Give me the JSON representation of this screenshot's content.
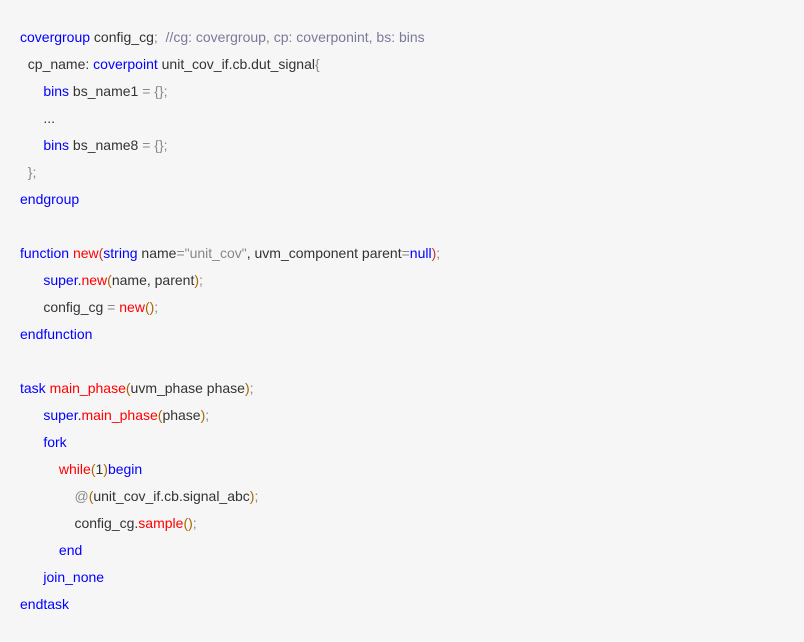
{
  "lines": {
    "l1": {
      "covergroup": "covergroup",
      "config_cg": " config_cg",
      "semi": ";",
      "sp": "  ",
      "comment": "//cg: covergroup, cp: coverponint, bs: bins"
    },
    "l2": {
      "indent": "  ",
      "cp_name": "cp_name: ",
      "coverpoint": "coverpoint",
      "path": " unit_cov_if.cb.dut_signal",
      "brace": "{"
    },
    "l3": {
      "indent": "      ",
      "bins": "bins",
      "name": " bs_name1 ",
      "eq": "= ",
      "braces": "{}",
      "semi": ";"
    },
    "l4": {
      "indent": "      ",
      "dots": "..."
    },
    "l5": {
      "indent": "      ",
      "bins": "bins",
      "name": " bs_name8 ",
      "eq": "= ",
      "braces": "{}",
      "semi": ";"
    },
    "l6": {
      "indent": "  ",
      "brace": "}",
      "semi": ";"
    },
    "l7": {
      "endgroup": "endgroup"
    },
    "l8": {
      "blank": ""
    },
    "l9": {
      "function": "function",
      "sp": " ",
      "new": "new",
      "lp": "(",
      "string": "string",
      "name_eq": " name",
      "eq": "=",
      "str": "\"unit_cov\"",
      "comma": ", uvm_component parent",
      "eq2": "=",
      "null": "null",
      "rp": ")",
      "semi": ";"
    },
    "l10": {
      "indent": "      ",
      "super": "super",
      "dot": ".",
      "new": "new",
      "lp": "(",
      "args": "name, parent",
      "rp": ")",
      "semi": ";"
    },
    "l11": {
      "indent": "      ",
      "config": "config_cg ",
      "eq": "= ",
      "new": "new",
      "lp": "(",
      "rp": ")",
      "semi": ";"
    },
    "l12": {
      "endfunction": "endfunction"
    },
    "l13": {
      "blank": ""
    },
    "l14": {
      "task": "task",
      "sp": " ",
      "main_phase": "main_phase",
      "lp": "(",
      "args": "uvm_phase phase",
      "rp": ")",
      "semi": ";"
    },
    "l15": {
      "indent": "      ",
      "super": "super",
      "dot": ".",
      "main_phase": "main_phase",
      "lp": "(",
      "args": "phase",
      "rp": ")",
      "semi": ";"
    },
    "l16": {
      "indent": "      ",
      "fork": "fork"
    },
    "l17": {
      "indent": "          ",
      "while": "while",
      "lp": "(",
      "one": "1",
      "rp": ")",
      "begin": "begin"
    },
    "l18": {
      "indent": "              ",
      "at": "@",
      "lp": "(",
      "path": "unit_cov_if.cb.signal_abc",
      "rp": ")",
      "semi": ";"
    },
    "l19": {
      "indent": "              ",
      "config": "config_cg.",
      "sample": "sample",
      "lp": "(",
      "rp": ")",
      "semi": ";"
    },
    "l20": {
      "indent": "          ",
      "end": "end"
    },
    "l21": {
      "indent": "      ",
      "join_none": "join_none"
    },
    "l22": {
      "endtask": "endtask"
    }
  }
}
